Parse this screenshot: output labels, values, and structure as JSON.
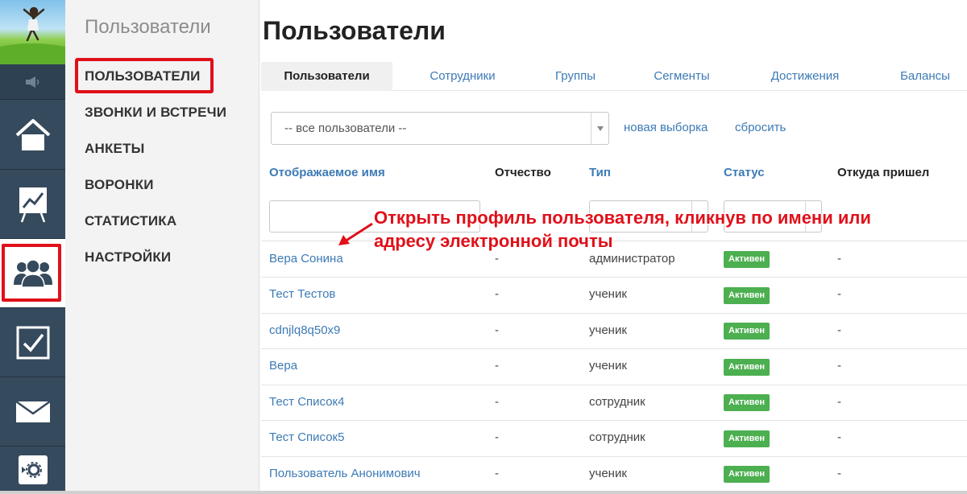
{
  "rail": {
    "items": [
      {
        "icon": "speaker-icon"
      },
      {
        "icon": "home-icon"
      },
      {
        "icon": "chart-board-icon"
      },
      {
        "icon": "users-icon",
        "active": true
      },
      {
        "icon": "checkbox-icon"
      },
      {
        "icon": "envelope-icon"
      },
      {
        "icon": "settings-icon"
      }
    ]
  },
  "submenu": {
    "title": "Пользователи",
    "items": [
      "ПОЛЬЗОВАТЕЛИ",
      "ЗВОНКИ И ВСТРЕЧИ",
      "АНКЕТЫ",
      "ВОРОНКИ",
      "СТАТИСТИКА",
      "НАСТРОЙКИ"
    ]
  },
  "main": {
    "title": "Пользователи",
    "tabs": [
      "Пользователи",
      "Сотрудники",
      "Группы",
      "Сегменты",
      "Достижения",
      "Балансы"
    ],
    "filter": {
      "selected": "-- все пользователи --",
      "new_selection": "новая выборка",
      "reset": "сбросить"
    },
    "columns": [
      "Отображаемое имя",
      "Отчество",
      "Тип",
      "Статус",
      "Откуда пришел"
    ],
    "rows": [
      {
        "name": "Вера Сонина",
        "patronymic": "-",
        "type": "администратор",
        "status": "Активен",
        "source": "-"
      },
      {
        "name": "Тест Тестов",
        "patronymic": "-",
        "type": "ученик",
        "status": "Активен",
        "source": "-"
      },
      {
        "name": "cdnjlq8q50x9",
        "patronymic": "-",
        "type": "ученик",
        "status": "Активен",
        "source": "-"
      },
      {
        "name": "Вера",
        "patronymic": "-",
        "type": "ученик",
        "status": "Активен",
        "source": "-"
      },
      {
        "name": "Тест Список4",
        "patronymic": "-",
        "type": "сотрудник",
        "status": "Активен",
        "source": "-"
      },
      {
        "name": "Тест Список5",
        "patronymic": "-",
        "type": "сотрудник",
        "status": "Активен",
        "source": "-"
      },
      {
        "name": "Пользователь Анонимович",
        "patronymic": "-",
        "type": "ученик",
        "status": "Активен",
        "source": "-"
      }
    ]
  },
  "annotation": {
    "line1": "Открыть профиль пользователя, кликнув по имени или",
    "line2": "адресу электронной почты"
  },
  "colors": {
    "rail": "#364a5e",
    "link": "#3d7ab5",
    "highlight": "#e0101a",
    "status_active": "#4caf50"
  }
}
